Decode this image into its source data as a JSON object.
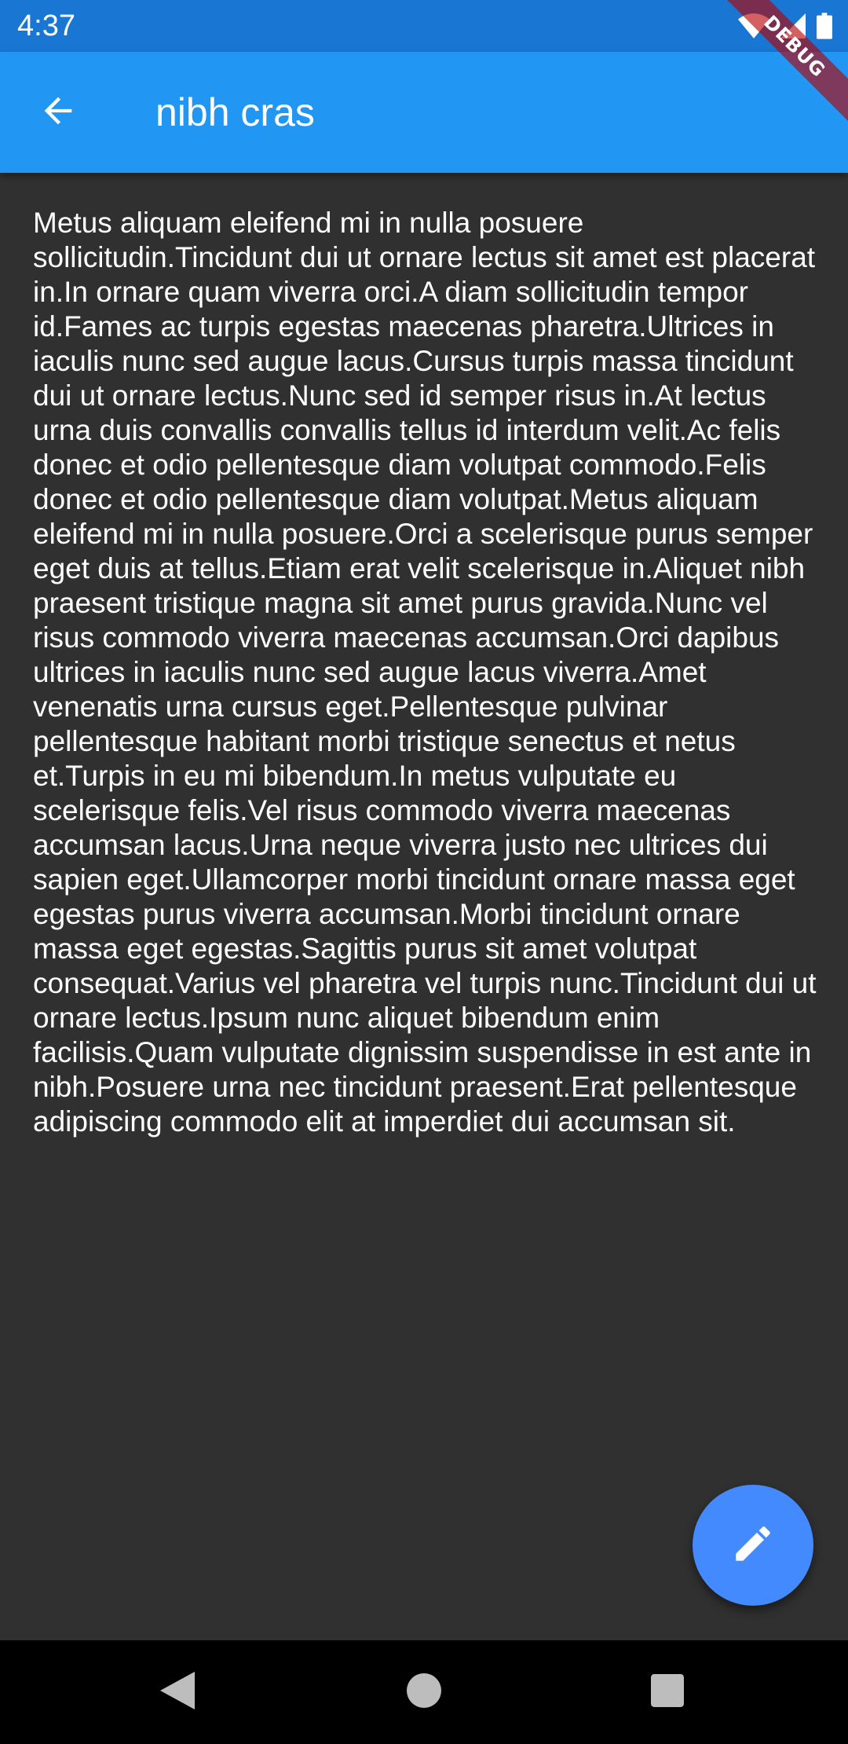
{
  "status_bar": {
    "time": "4:37",
    "icons": [
      "wifi-icon",
      "signal-icon",
      "battery-icon"
    ]
  },
  "debug_banner": {
    "label": "DEBUG"
  },
  "app_bar": {
    "back_icon": "arrow-back-icon",
    "title": "nibh cras"
  },
  "body": {
    "text": "Metus aliquam eleifend mi in nulla posuere sollicitudin.Tincidunt dui ut ornare lectus sit amet est placerat in.In ornare quam viverra orci.A diam sollicitudin tempor id.Fames ac turpis egestas maecenas pharetra.Ultrices in iaculis nunc sed augue lacus.Cursus turpis massa tincidunt dui ut ornare lectus.Nunc sed id semper risus in.At lectus urna duis convallis convallis tellus id interdum velit.Ac felis donec et odio pellentesque diam volutpat commodo.Felis donec et odio pellentesque diam volutpat.Metus aliquam eleifend mi in nulla posuere.Orci a scelerisque purus semper eget duis at tellus.Etiam erat velit scelerisque in.Aliquet nibh praesent tristique magna sit amet purus gravida.Nunc vel risus commodo viverra maecenas accumsan.Orci dapibus ultrices in iaculis nunc sed augue lacus viverra.Amet venenatis urna cursus eget.Pellentesque pulvinar pellentesque habitant morbi tristique senectus et netus et.Turpis in eu mi bibendum.In metus vulputate eu scelerisque felis.Vel risus commodo viverra maecenas accumsan lacus.Urna neque viverra justo nec ultrices dui sapien eget.Ullamcorper morbi tincidunt ornare massa eget egestas purus viverra accumsan.Morbi tincidunt ornare massa eget egestas.Sagittis purus sit amet volutpat consequat.Varius vel pharetra vel turpis nunc.Tincidunt dui ut ornare lectus.Ipsum nunc aliquet bibendum enim facilisis.Quam vulputate dignissim suspendisse in est ante in nibh.Posuere urna nec tincidunt praesent.Erat pellentesque adipiscing commodo elit at imperdiet dui accumsan sit."
  },
  "fab": {
    "icon": "edit-pencil-icon"
  },
  "nav_bar": {
    "icons": [
      "nav-back-icon",
      "nav-home-icon",
      "nav-recents-icon"
    ]
  },
  "colors": {
    "status_bar": "#1976D2",
    "app_bar": "#2196F3",
    "background": "#303030",
    "fab": "#448AFF",
    "nav_bar": "#000000",
    "text": "#FFFFFF"
  }
}
